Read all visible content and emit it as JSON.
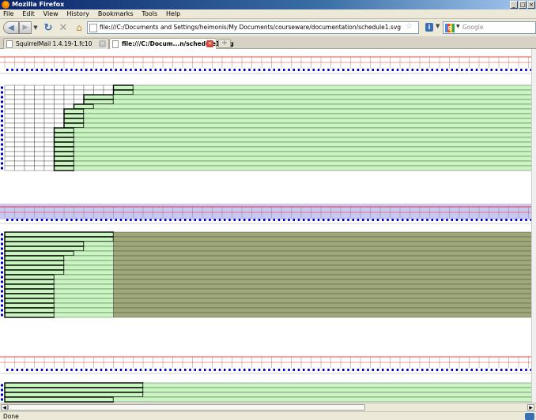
{
  "window": {
    "title": "Mozilla Firefox",
    "controls": [
      "_",
      "□",
      "×"
    ]
  },
  "menu": [
    "File",
    "Edit",
    "View",
    "History",
    "Bookmarks",
    "Tools",
    "Help"
  ],
  "nav": {
    "url": "file:///C:/Documents and Settings/heimonis/My Documents/courseware/documentation/schedule1.svg",
    "search_placeholder": "Google"
  },
  "tabs": [
    {
      "label": "SquirrelMail 1.4.19-1.fc10",
      "active": false
    },
    {
      "label": "file:///C:/Docum...n/schedule1.svg",
      "active": true
    }
  ],
  "status": {
    "text": "Done"
  },
  "colors": {
    "grid_line": "#404040",
    "free_fill": "#c8f5c0",
    "busy_fill": "#9fa878",
    "header_band": "#c8c8f0",
    "ruler_red": "#ff0000",
    "ruler_blue": "#0000cc"
  },
  "schedules": [
    {
      "columns": 64,
      "rows": 18,
      "boxes": [
        [
          11,
          13
        ],
        [
          11,
          13
        ],
        [
          8,
          11
        ],
        [
          8,
          11
        ],
        [
          7,
          9
        ],
        [
          6,
          8
        ],
        [
          6,
          8
        ],
        [
          6,
          8
        ],
        [
          6,
          8
        ],
        [
          5,
          7
        ],
        [
          5,
          7
        ],
        [
          5,
          7
        ],
        [
          5,
          7
        ],
        [
          5,
          7
        ],
        [
          5,
          7
        ],
        [
          5,
          7
        ],
        [
          5,
          7
        ],
        [
          5,
          7
        ]
      ]
    },
    {
      "columns": 64,
      "rows": 18,
      "boxes": [
        [
          0,
          11
        ],
        [
          0,
          11
        ],
        [
          0,
          8
        ],
        [
          0,
          8
        ],
        [
          0,
          7
        ],
        [
          0,
          6
        ],
        [
          0,
          6
        ],
        [
          0,
          6
        ],
        [
          0,
          6
        ],
        [
          0,
          5
        ],
        [
          0,
          5
        ],
        [
          0,
          5
        ],
        [
          0,
          5
        ],
        [
          0,
          5
        ],
        [
          0,
          5
        ],
        [
          0,
          5
        ],
        [
          0,
          5
        ],
        [
          0,
          5
        ]
      ]
    },
    {
      "columns": 64,
      "rows": 4,
      "boxes": [
        [
          0,
          14
        ],
        [
          0,
          14
        ],
        [
          0,
          14
        ],
        [
          0,
          11
        ]
      ]
    }
  ]
}
